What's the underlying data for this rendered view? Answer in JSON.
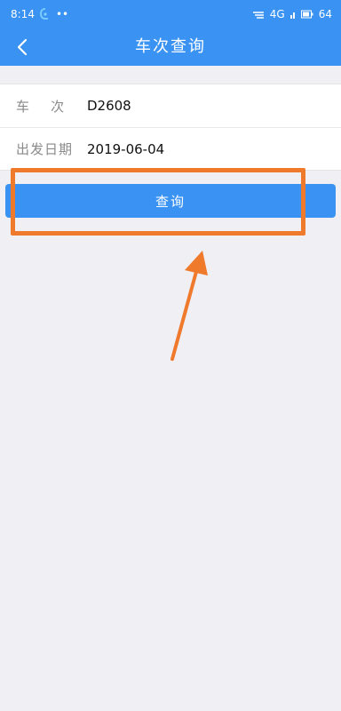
{
  "status_bar": {
    "time": "8:14",
    "dots": "••",
    "network": "4G",
    "battery": "64"
  },
  "header": {
    "title": "车次查询"
  },
  "form": {
    "train_label": "车    次",
    "train_value": "D2608",
    "date_label": "出发日期",
    "date_value": "2019-06-04"
  },
  "query_button": {
    "label": "查询"
  },
  "colors": {
    "primary": "#3a93f2",
    "background": "#efeff4",
    "annotation": "#f07a2c"
  }
}
